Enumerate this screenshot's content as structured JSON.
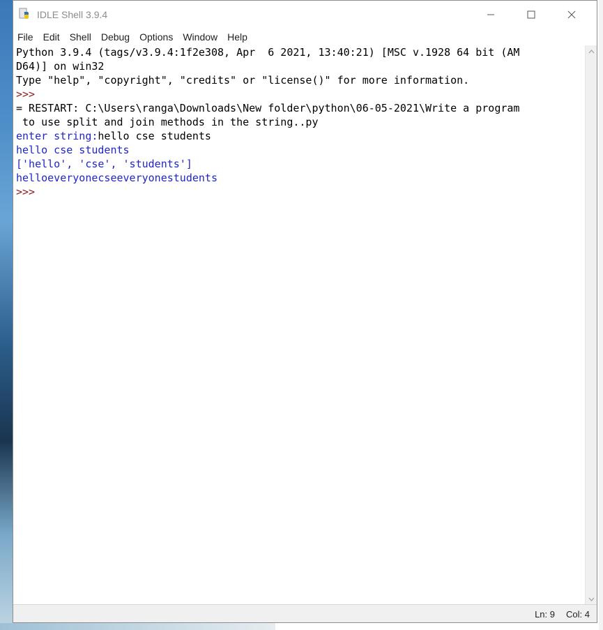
{
  "window": {
    "title": "IDLE Shell 3.9.4",
    "controls": {
      "minimize": "—",
      "maximize": "☐",
      "close": "✕"
    }
  },
  "menubar": {
    "items": [
      "File",
      "Edit",
      "Shell",
      "Debug",
      "Options",
      "Window",
      "Help"
    ]
  },
  "shell": {
    "lines": [
      {
        "type": "info",
        "text": "Python 3.9.4 (tags/v3.9.4:1f2e308, Apr  6 2021, 13:40:21) [MSC v.1928 64 bit (AM"
      },
      {
        "type": "info",
        "text": "D64)] on win32"
      },
      {
        "type": "info",
        "text": "Type \"help\", \"copyright\", \"credits\" or \"license()\" for more information."
      },
      {
        "type": "prompt",
        "text": ">>> "
      },
      {
        "type": "info",
        "text": "= RESTART: C:\\Users\\ranga\\Downloads\\New folder\\python\\06-05-2021\\Write a program"
      },
      {
        "type": "info",
        "text": " to use split and join methods in the string..py"
      },
      {
        "type": "mixed",
        "parts": [
          {
            "cls": "stdout",
            "text": "enter string:"
          },
          {
            "cls": "stdin",
            "text": "hello cse students"
          }
        ]
      },
      {
        "type": "stdout",
        "text": "hello cse students"
      },
      {
        "type": "stdout",
        "text": "['hello', 'cse', 'students']"
      },
      {
        "type": "stdout",
        "text": "helloeveryonecseeveryonestudents"
      },
      {
        "type": "prompt",
        "text": ">>> "
      }
    ]
  },
  "statusbar": {
    "ln": "Ln: 9",
    "col": "Col: 4"
  },
  "icons": {
    "app": "python-idle-icon",
    "scroll_up": "chevron-up-icon",
    "scroll_down": "chevron-down-icon"
  }
}
